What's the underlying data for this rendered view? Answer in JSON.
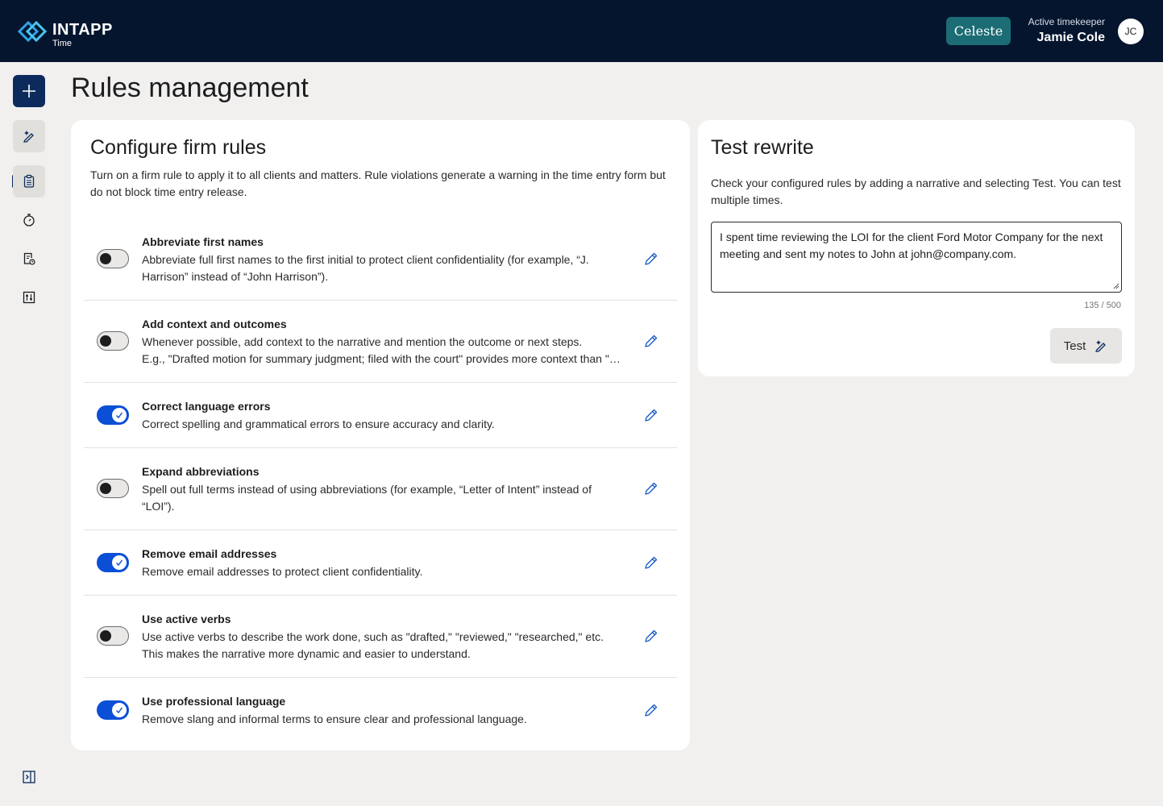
{
  "header": {
    "brand": "INTAPP",
    "product": "Time",
    "assistant_label": "Celeste",
    "timekeeper_label": "Active timekeeper",
    "timekeeper_name": "Jamie Cole",
    "avatar_initials": "JC"
  },
  "sidebar": {
    "items": [
      {
        "icon": "plus-icon",
        "active": false
      },
      {
        "icon": "rewrite-icon",
        "active": false
      },
      {
        "icon": "clipboard-icon",
        "active": true
      },
      {
        "icon": "stopwatch-icon",
        "active": false
      },
      {
        "icon": "report-icon",
        "active": false
      },
      {
        "icon": "sliders-icon",
        "active": false
      }
    ],
    "collapse_icon": "collapse-panel-icon"
  },
  "page": {
    "title": "Rules management"
  },
  "rules_card": {
    "title": "Configure firm rules",
    "description": "Turn on a firm rule to apply it to all clients and matters. Rule violations generate a warning in the time entry form but do not block time entry release.",
    "rules": [
      {
        "title": "Abbreviate first names",
        "enabled": false,
        "line1": "Abbreviate full first names to the first initial to protect client confidentiality (for example, “J.",
        "line2": "Harrison” instead of “John Harrison”)."
      },
      {
        "title": "Add context and outcomes",
        "enabled": false,
        "line1": "Whenever possible, add context to the narrative and mention the  outcome or next steps.",
        "line2": "E.g., \"Drafted motion for summary judgment;  filed with the court\" provides more context than \"Drafted motion\"."
      },
      {
        "title": "Correct language errors",
        "enabled": true,
        "line1": "Correct spelling and grammatical errors to ensure accuracy and clarity.",
        "line2": ""
      },
      {
        "title": "Expand abbreviations",
        "enabled": false,
        "line1": "Spell out full terms instead of using abbreviations (for example, “Letter of Intent” instead of",
        "line2": "“LOI”)."
      },
      {
        "title": "Remove email addresses",
        "enabled": true,
        "line1": "Remove email addresses to protect client confidentiality.",
        "line2": ""
      },
      {
        "title": "Use active verbs",
        "enabled": false,
        "line1": "Use active verbs to describe the work done, such as \"drafted,\"  \"reviewed,\" \"researched,\" etc.",
        "line2": "This makes the narrative more dynamic and easier to understand."
      },
      {
        "title": "Use professional language",
        "enabled": true,
        "line1": "Remove slang and informal terms to ensure clear and professional language.",
        "line2": ""
      }
    ]
  },
  "test_card": {
    "title": "Test rewrite",
    "description": "Check your configured rules by adding a narrative and selecting Test. You can test multiple times.",
    "narrative": "I spent time reviewing the LOI for the client Ford Motor Company for the next meeting and sent my notes to John at john@company.com.",
    "counter": "135 / 500",
    "test_label": "Test"
  },
  "colors": {
    "header_bg": "#05152e",
    "accent_teal": "#1b6c74",
    "toggle_on": "#0b4fd6",
    "primary_navy": "#0c2b5c"
  }
}
